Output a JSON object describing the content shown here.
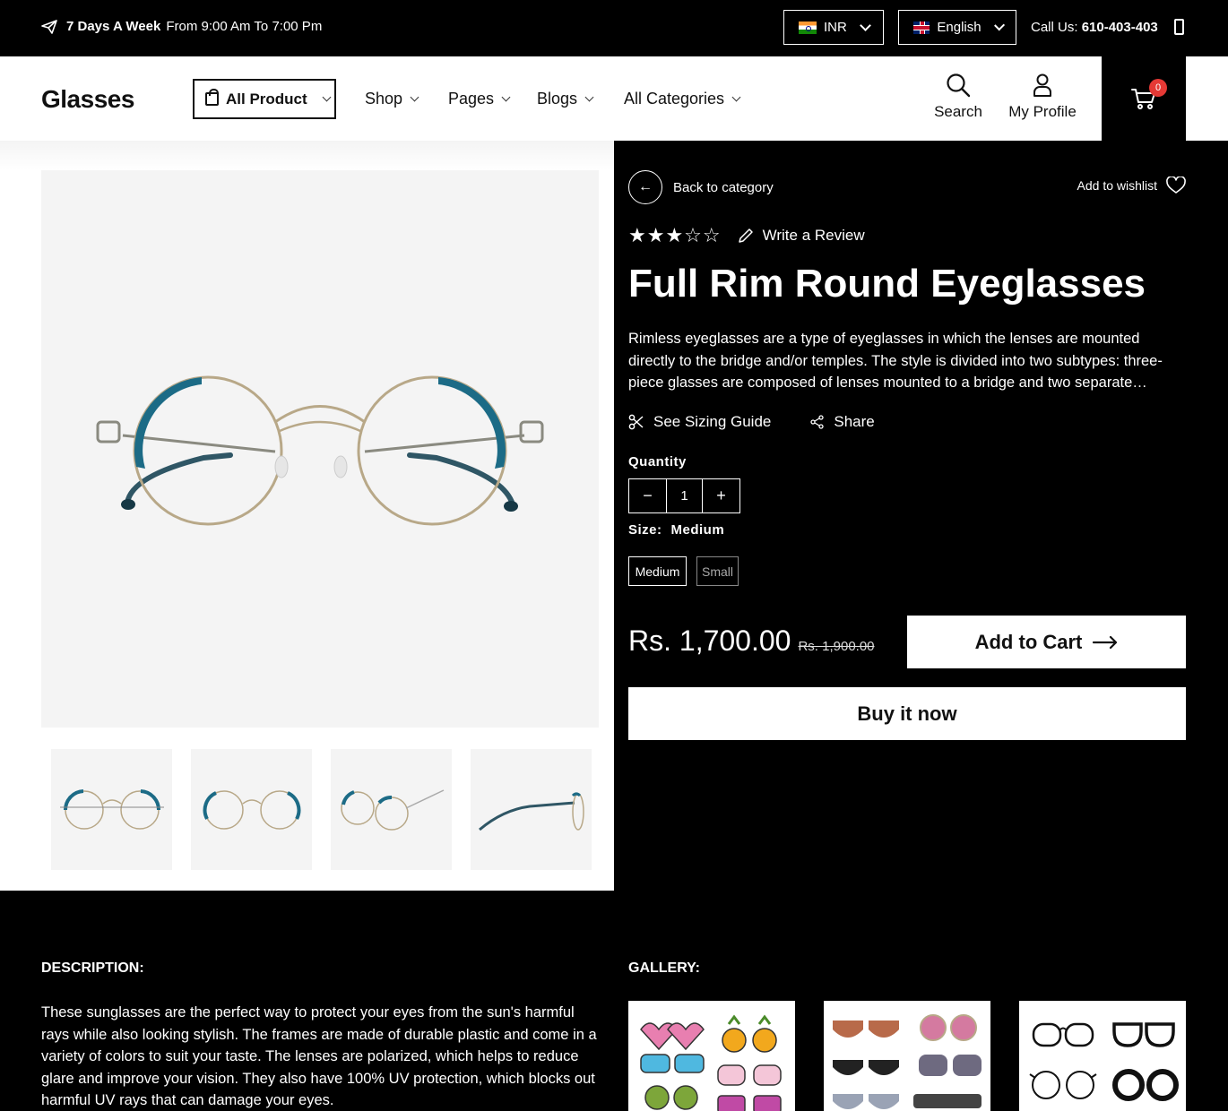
{
  "topbar": {
    "hours_bold": "7 Days A Week",
    "hours_text": "From 9:00 Am To 7:00 Pm",
    "currency": "INR",
    "language": "English",
    "call_label": "Call Us:",
    "call_number": "610-403-403"
  },
  "header": {
    "logo": "Glasses",
    "all_product": "All Product",
    "nav": [
      "Shop",
      "Pages",
      "Blogs",
      "All Categories"
    ],
    "search_label": "Search",
    "profile_label": "My Profile",
    "cart_count": "0"
  },
  "product": {
    "back_label": "Back to category",
    "wishlist_label": "Add to wishlist",
    "rating": 3,
    "rating_max": 5,
    "write_review": "Write a Review",
    "title": "Full Rim Round Eyeglasses",
    "description": "Rimless eyeglasses are a type of eyeglasses in which the lenses are mounted directly to the bridge and/or temples. The style is divided into two subtypes: three-piece glasses are composed of lenses mounted to a bridge and two separate temples.",
    "sizing_guide": "See Sizing Guide",
    "share": "Share",
    "quantity_label": "Quantity",
    "quantity": "1",
    "size_label": "Size:",
    "size_selected": "Medium",
    "sizes": [
      "Medium",
      "Small"
    ],
    "price": "Rs. 1,700.00",
    "compare_price": "Rs. 1,900.00",
    "add_to_cart": "Add to Cart",
    "buy_now": "Buy it now"
  },
  "bottom": {
    "description_heading": "DESCRIPTION:",
    "description_text": "These sunglasses are the perfect way to protect your eyes from the sun's harmful rays while also looking stylish. The frames are made of durable plastic and come in a variety of colors to suit your taste. The lenses are polarized, which helps to reduce glare and improve your vision. They also have 100% UV protection, which blocks out harmful UV rays that can damage your eyes.",
    "gallery_heading": "GALLERY:"
  },
  "colors": {
    "accent_teal": "#1c6b86",
    "badge_red": "#e53935"
  }
}
